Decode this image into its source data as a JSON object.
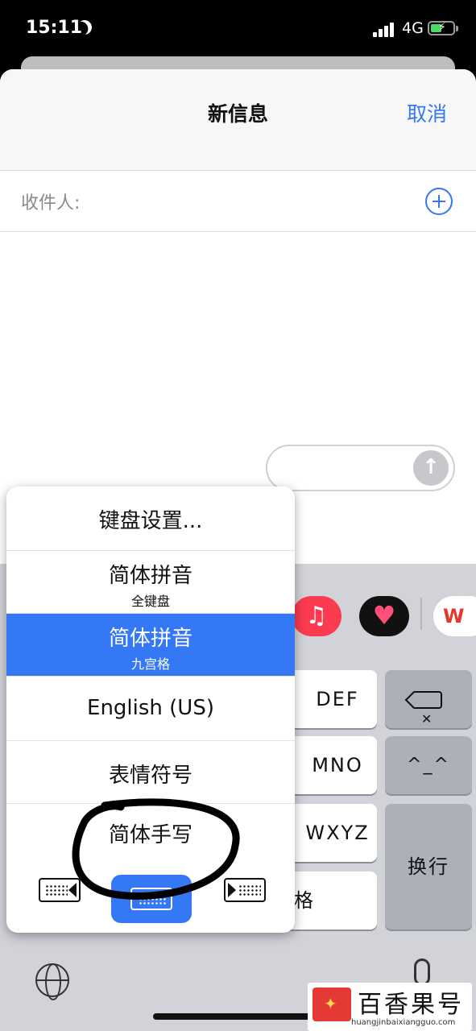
{
  "status": {
    "time": "15:11",
    "network": "4G"
  },
  "nav": {
    "title": "新信息",
    "cancel": "取消"
  },
  "recipient": {
    "label": "收件人:"
  },
  "keyboard": {
    "keys": {
      "def": "DEF",
      "mno": "MNO",
      "wxyz": "WXYZ",
      "space": "格",
      "face": "^_^",
      "return": "换行"
    }
  },
  "input_menu": {
    "items": [
      {
        "label": "键盘设置..."
      },
      {
        "label": "简体拼音",
        "sub": "全键盘"
      },
      {
        "label": "简体拼音",
        "sub": "九宫格",
        "selected": true
      },
      {
        "label": "English (US)"
      },
      {
        "label": "表情符号"
      },
      {
        "label": "简体手写"
      }
    ]
  },
  "watermark": {
    "brand": "百香果号",
    "url": "huangjinbaixiangguo.com"
  },
  "colors": {
    "accent": "#3478f6",
    "keyboard_bg": "#d1d3d9",
    "annotation": "#000000"
  },
  "icons": [
    "moon-icon",
    "signal-icon",
    "battery-icon",
    "add-icon",
    "send-icon",
    "music-app-icon",
    "heart-app-icon",
    "wps-app-icon",
    "delete-icon",
    "globe-icon",
    "mic-icon"
  ]
}
